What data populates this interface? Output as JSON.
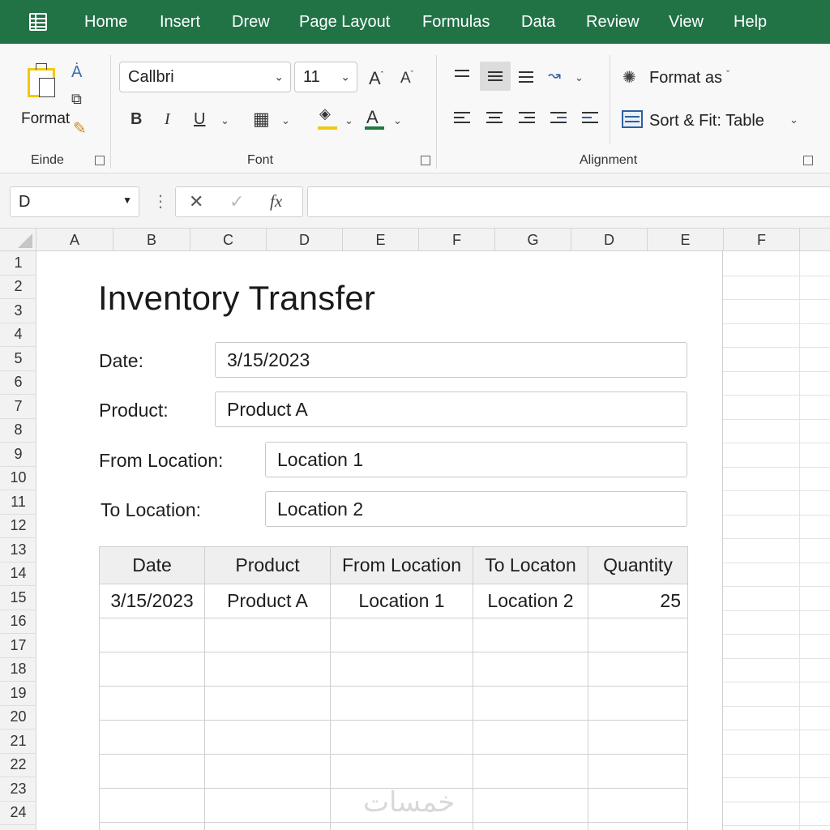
{
  "menu": {
    "items": [
      "Home",
      "Insert",
      "Drew",
      "Page Layout",
      "Formulas",
      "Data",
      "Review",
      "View",
      "Help"
    ]
  },
  "ribbon": {
    "clipboard": {
      "format_label": "Format",
      "group_label": "Einde"
    },
    "font": {
      "font_name": "Callbri",
      "font_size": "11",
      "group_label": "Font",
      "bold": "B",
      "italic": "I",
      "underline": "U",
      "font_color_letter": "A"
    },
    "alignment": {
      "group_label": "Alignment"
    },
    "styles": {
      "format_as_label": "Format as",
      "sort_fit_label": "Sort & Fit: Table"
    }
  },
  "formula_bar": {
    "name_box": "D",
    "formula": ""
  },
  "columns": [
    "A",
    "B",
    "C",
    "D",
    "E",
    "F",
    "G",
    "D",
    "E",
    "F"
  ],
  "rows": [
    "1",
    "2",
    "3",
    "4",
    "5",
    "6",
    "7",
    "8",
    "9",
    "10",
    "11",
    "12",
    "13",
    "14",
    "15",
    "16",
    "17",
    "18",
    "19",
    "20",
    "21",
    "22",
    "23",
    "24"
  ],
  "form": {
    "title": "Inventory Transfer",
    "date_label": "Date:",
    "date_value": "3/15/2023",
    "product_label": "Product:",
    "product_value": "Product A",
    "from_label": "From Location:",
    "from_value": "Location 1",
    "to_label": "To Location:",
    "to_value": "Location 2"
  },
  "table": {
    "headers": [
      "Date",
      "Product",
      "From Location",
      "To Locaton",
      "Quantity"
    ],
    "rows": [
      [
        "3/15/2023",
        "Product A",
        "Location 1",
        "Location 2",
        "25"
      ]
    ],
    "empty_rows": 7
  },
  "watermark": "خمسات",
  "colors": {
    "accent": "#217346",
    "highlight": "#f2c811",
    "font_color": "#1e7a3c"
  }
}
